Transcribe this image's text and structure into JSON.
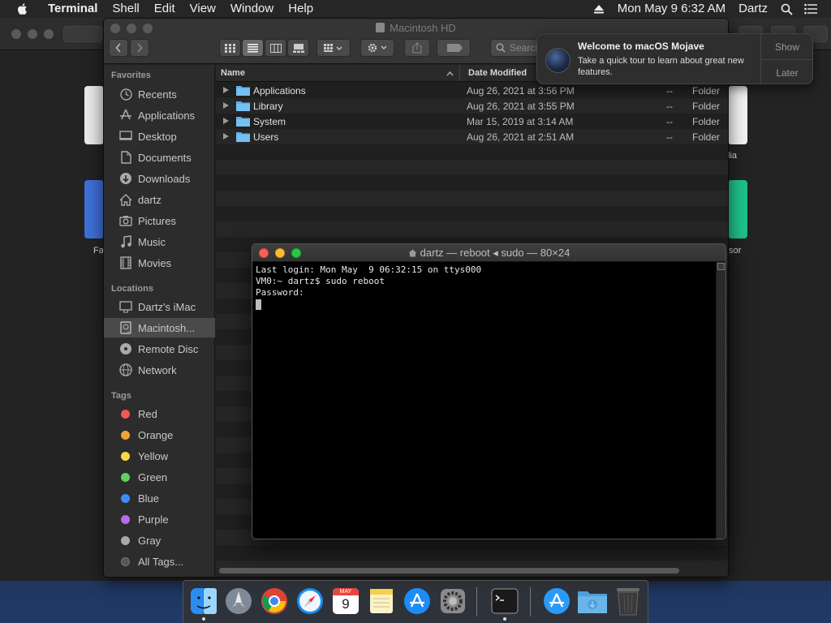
{
  "menubar": {
    "app_name": "Terminal",
    "menus": [
      "Shell",
      "Edit",
      "View",
      "Window",
      "Help"
    ],
    "clock": "Mon May 9  6:32 AM",
    "user": "Dartz"
  },
  "finder": {
    "title": "Macintosh HD",
    "search_placeholder": "Search",
    "sidebar": {
      "favorites_header": "Favorites",
      "favorites": [
        {
          "label": "Recents",
          "icon": "clock-icon"
        },
        {
          "label": "Applications",
          "icon": "applications-icon"
        },
        {
          "label": "Desktop",
          "icon": "desktop-icon"
        },
        {
          "label": "Documents",
          "icon": "document-icon"
        },
        {
          "label": "Downloads",
          "icon": "download-icon"
        },
        {
          "label": "dartz",
          "icon": "home-icon"
        },
        {
          "label": "Pictures",
          "icon": "camera-icon"
        },
        {
          "label": "Music",
          "icon": "music-note-icon"
        },
        {
          "label": "Movies",
          "icon": "film-icon"
        }
      ],
      "locations_header": "Locations",
      "locations": [
        {
          "label": "Dartz's iMac",
          "icon": "imac-icon"
        },
        {
          "label": "Macintosh...",
          "icon": "hard-drive-icon",
          "selected": true
        },
        {
          "label": "Remote Disc",
          "icon": "disc-icon"
        },
        {
          "label": "Network",
          "icon": "globe-icon"
        }
      ],
      "tags_header": "Tags",
      "tags": [
        {
          "label": "Red",
          "color": "#ee5a55"
        },
        {
          "label": "Orange",
          "color": "#f3a03a"
        },
        {
          "label": "Yellow",
          "color": "#f7d84a"
        },
        {
          "label": "Green",
          "color": "#5cd35a"
        },
        {
          "label": "Blue",
          "color": "#3d8ff5"
        },
        {
          "label": "Purple",
          "color": "#b66bea"
        },
        {
          "label": "Gray",
          "color": "#a8a8a8"
        }
      ],
      "all_tags": "All Tags..."
    },
    "columns": {
      "name": "Name",
      "date_modified": "Date Modified"
    },
    "files": [
      {
        "name": "Applications",
        "date": "Aug 26, 2021 at 3:56 PM",
        "size": "--",
        "kind": "Folder"
      },
      {
        "name": "Library",
        "date": "Aug 26, 2021 at 3:55 PM",
        "size": "--",
        "kind": "Folder"
      },
      {
        "name": "System",
        "date": "Mar 15, 2019 at 3:14 AM",
        "size": "--",
        "kind": "Folder"
      },
      {
        "name": "Users",
        "date": "Aug 26, 2021 at 2:51 AM",
        "size": "--",
        "kind": "Folder"
      }
    ]
  },
  "notification": {
    "title": "Welcome to macOS Mojave",
    "body": "Take a quick tour to learn about great new features.",
    "show_label": "Show",
    "later_label": "Later"
  },
  "terminal": {
    "title": "dartz — reboot ◂ sudo — 80×24",
    "lines": [
      "Last login: Mon May  9 06:32:15 on ttys000",
      "VM0:~ dartz$ sudo reboot",
      "Password:"
    ]
  },
  "desktop_peek": {
    "label_left_1": "Fa",
    "label_right_1": "lia",
    "label_right_2": "sor"
  },
  "dock": {
    "items": [
      "Finder",
      "Launchpad",
      "Chrome",
      "Safari",
      "Calendar",
      "Notes",
      "App Store",
      "System Preferences",
      "Terminal",
      "App Store",
      "Downloads",
      "Trash"
    ],
    "calendar_month": "MAY",
    "calendar_day": "9"
  },
  "colors": {
    "accent": "#3d8ff5",
    "folder": "#5fb0e8"
  }
}
